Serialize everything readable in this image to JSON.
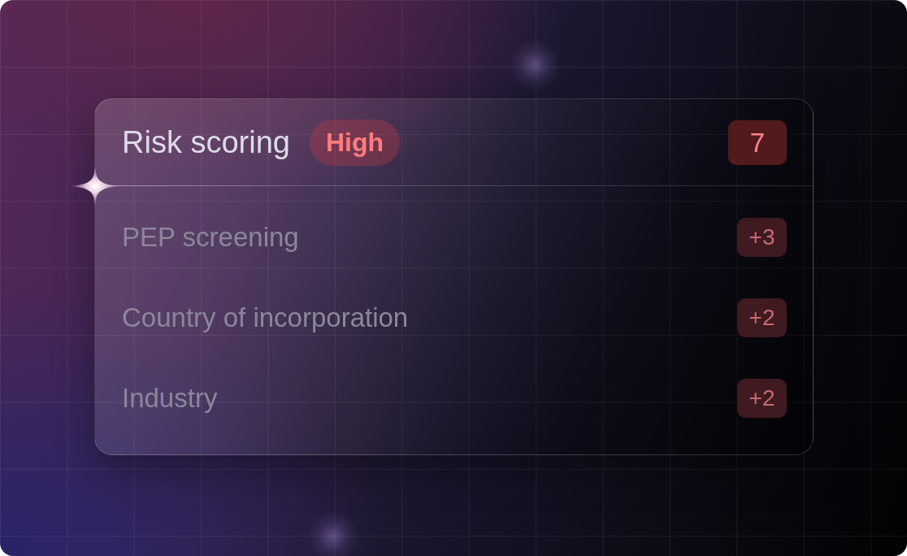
{
  "card": {
    "title": "Risk scoring",
    "risk_level": "High",
    "score": "7",
    "factors": [
      {
        "label": "PEP screening",
        "points": "+3"
      },
      {
        "label": "Country of incorporation",
        "points": "+2"
      },
      {
        "label": "Industry",
        "points": "+2"
      }
    ]
  }
}
